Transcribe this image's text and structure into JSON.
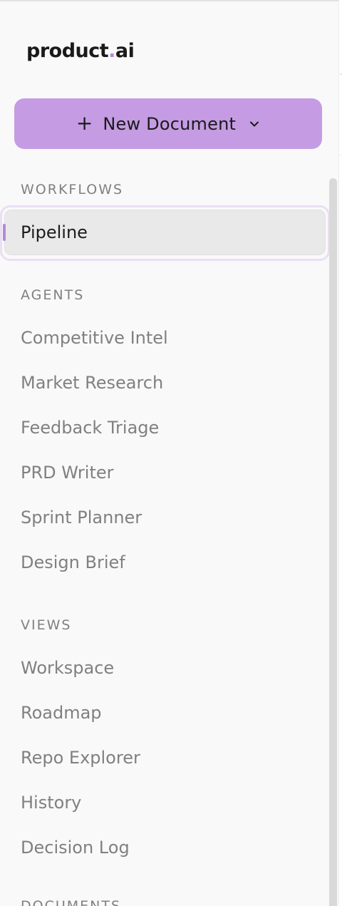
{
  "brand": {
    "name_part1": "product",
    "dot": ".",
    "name_part2": "ai"
  },
  "new_document_button": {
    "icon": "plus-icon",
    "label": "New Document",
    "chevron": "chevron-down-icon"
  },
  "sections": {
    "workflows": {
      "label": "WORKFLOWS",
      "items": [
        {
          "label": "Pipeline",
          "active": true
        }
      ]
    },
    "agents": {
      "label": "AGENTS",
      "items": [
        {
          "label": "Competitive Intel"
        },
        {
          "label": "Market Research"
        },
        {
          "label": "Feedback Triage"
        },
        {
          "label": "PRD Writer"
        },
        {
          "label": "Sprint Planner"
        },
        {
          "label": "Design Brief"
        }
      ]
    },
    "views": {
      "label": "VIEWS",
      "items": [
        {
          "label": "Workspace"
        },
        {
          "label": "Roadmap"
        },
        {
          "label": "Repo Explorer"
        },
        {
          "label": "History"
        },
        {
          "label": "Decision Log"
        }
      ]
    },
    "documents": {
      "label": "DOCUMENTS"
    }
  },
  "colors": {
    "accent": "#c59ce3",
    "active_bar": "#b48ad8",
    "muted_text": "#808080"
  }
}
